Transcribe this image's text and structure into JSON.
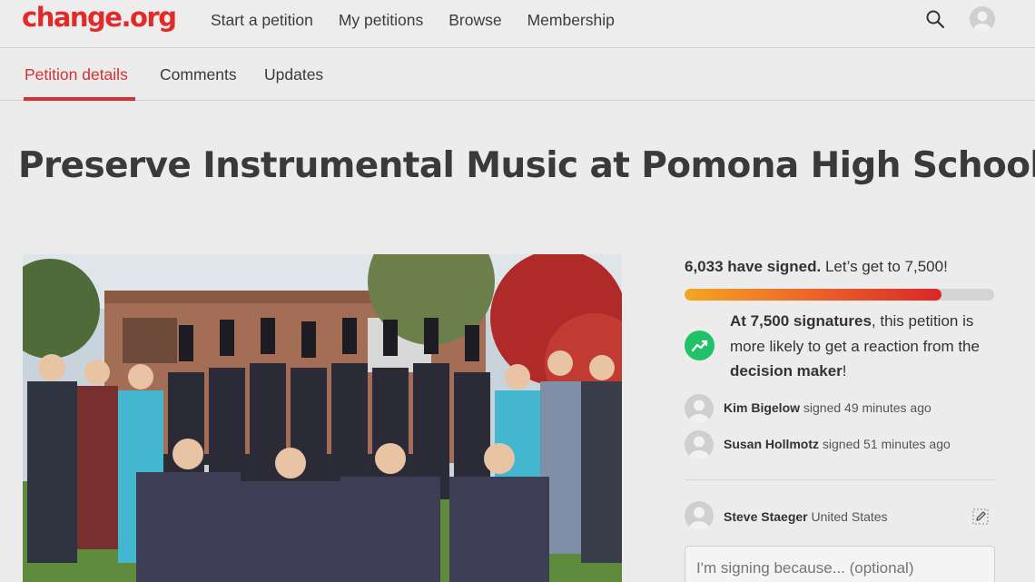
{
  "header": {
    "logo": "change.org",
    "nav": [
      "Start a petition",
      "My petitions",
      "Browse",
      "Membership"
    ]
  },
  "tabs": [
    "Petition details",
    "Comments",
    "Updates"
  ],
  "petition": {
    "title": "Preserve Instrumental Music at Pomona High School"
  },
  "signatures": {
    "count": "6,033 have signed.",
    "goal_text": " Let’s get to 7,500!",
    "progress": 0.83,
    "goal_strong": "At 7,500 signatures",
    "goal_mid": ", this petition is more likely to get a reaction from the ",
    "goal_strong2": "decision maker",
    "goal_end": "!"
  },
  "recent": [
    {
      "name": "Kim Bigelow",
      "text": " signed 49 minutes ago"
    },
    {
      "name": "Susan Hollmotz",
      "text": " signed 51 minutes ago"
    }
  ],
  "user": {
    "name": "Steve Staeger",
    "country": " United States"
  },
  "reason_placeholder": "I'm signing because... (optional)",
  "colors": {
    "brand": "#e12b2b",
    "progress_start": "#f2a623",
    "progress_end": "#d8272a",
    "trend": "#21c267"
  },
  "icons": [
    "search-icon",
    "user-avatar-icon",
    "trending-up-icon",
    "edit-icon"
  ]
}
